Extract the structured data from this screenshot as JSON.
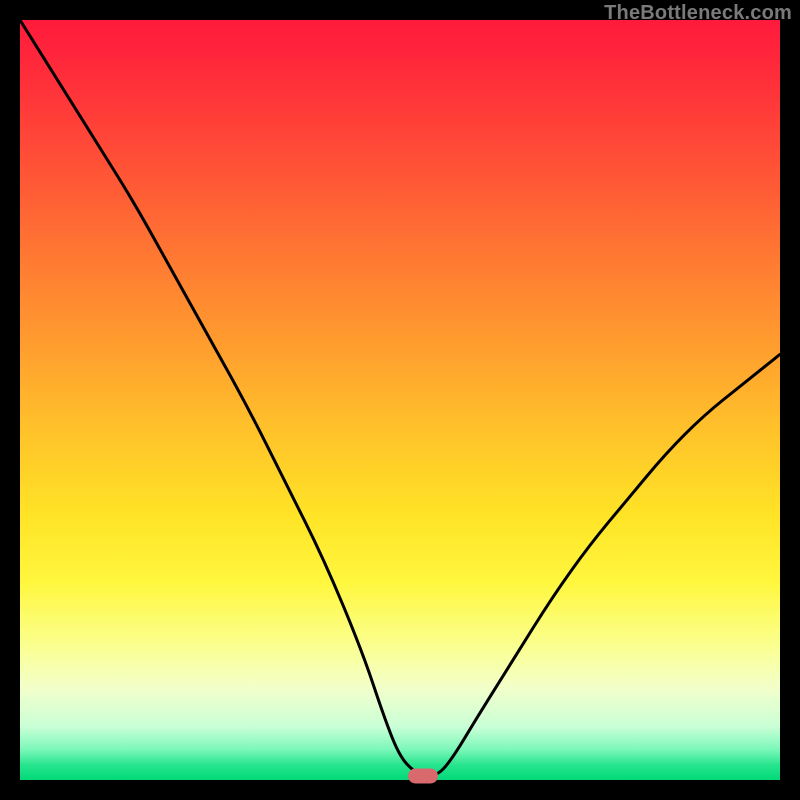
{
  "watermark": "TheBottleneck.com",
  "chart_data": {
    "type": "line",
    "title": "",
    "xlabel": "",
    "ylabel": "",
    "xlim": [
      0,
      100
    ],
    "ylim": [
      0,
      100
    ],
    "grid": false,
    "legend": false,
    "annotations": [],
    "background_gradient": [
      "#ff1a3c",
      "#ff7b32",
      "#ffe326",
      "#f2ffcb",
      "#00d977"
    ],
    "series": [
      {
        "name": "bottleneck-curve",
        "color": "#000000",
        "x": [
          0,
          5,
          10,
          15,
          20,
          25,
          30,
          35,
          40,
          45,
          48,
          50,
          52,
          53,
          55,
          57,
          60,
          65,
          70,
          75,
          80,
          85,
          90,
          95,
          100
        ],
        "values": [
          100,
          92,
          84,
          76,
          67,
          58,
          49,
          39,
          29,
          17,
          8,
          3,
          1,
          0.6,
          0.6,
          3,
          8,
          16,
          24,
          31,
          37,
          43,
          48,
          52,
          56
        ]
      }
    ],
    "marker": {
      "x": 53,
      "y": 0.5,
      "color": "#d86a6e"
    }
  }
}
